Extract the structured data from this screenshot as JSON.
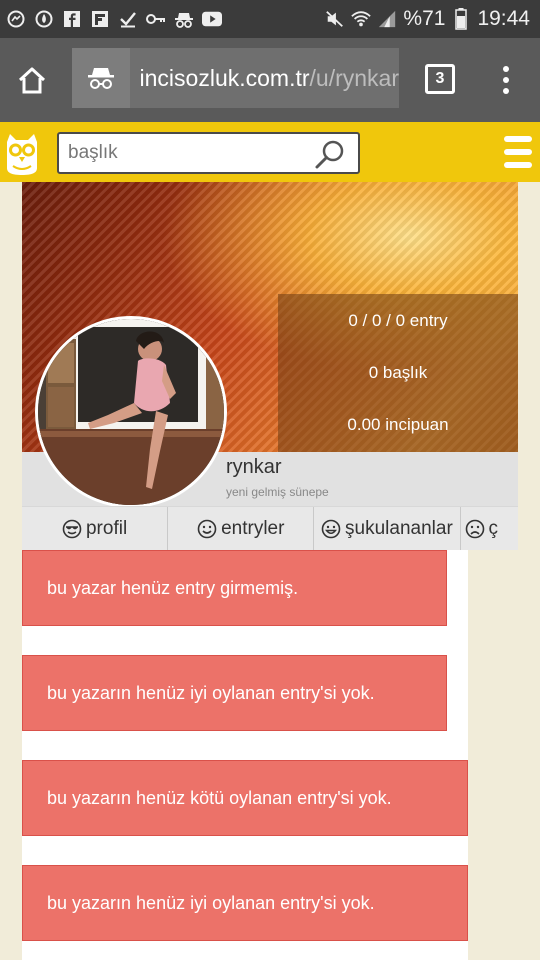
{
  "status_bar": {
    "icons": [
      "fb-messenger-icon",
      "fire-icon",
      "facebook-icon",
      "flipboard-icon",
      "check-icon",
      "key-icon",
      "incognito-icon",
      "youtube-icon"
    ],
    "right_icons": [
      "mute-icon",
      "wifi-icon",
      "signal-icon",
      "battery-icon"
    ],
    "battery": "%71",
    "time": "19:44"
  },
  "browser": {
    "url_domain": "incisozluk.com.tr",
    "url_path": "/u/rynkar",
    "tab_count": "3"
  },
  "header": {
    "search_placeholder": "başlık"
  },
  "profile": {
    "stats": {
      "entries": "0 / 0 / 0 entry",
      "topics": "0 başlık",
      "points": "0.00 incipuan"
    },
    "username": "rynkar",
    "user_title": "yeni gelmiş sünepe"
  },
  "tabs": [
    {
      "label": "profil"
    },
    {
      "label": "entryler"
    },
    {
      "label": "şukulananlar"
    },
    {
      "label": "ç"
    }
  ],
  "messages": [
    "bu yazar henüz entry girmemiş.",
    "bu yazarın henüz iyi oylanan entry'si yok.",
    "bu yazarın henüz kötü oylanan entry'si yok.",
    "bu yazarın henüz iyi oylanan entry'si yok."
  ],
  "colors": {
    "header_yellow": "#f0c70c",
    "alert_red": "#ec7269",
    "toolbar_gray": "#5a5a5a"
  }
}
